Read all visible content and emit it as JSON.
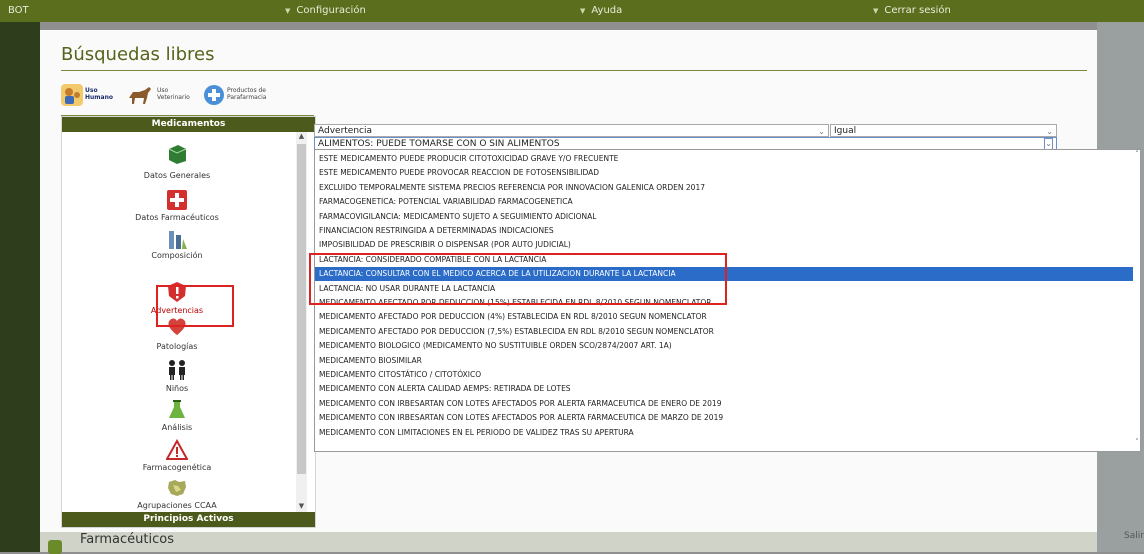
{
  "topbar": {
    "user": "BOT",
    "config": "Configuración",
    "help": "Ayuda",
    "logout": "Cerrar sesión"
  },
  "page": {
    "title": "Búsquedas libres",
    "salir": "Salir",
    "footer_partial": "Farmacéuticos"
  },
  "types": [
    {
      "label1": "Uso",
      "label2": "Humano",
      "icon": "human-use-icon"
    },
    {
      "label1": "Uso",
      "label2": "Veterinario",
      "icon": "horse-icon"
    },
    {
      "label1": "Productos de",
      "label2": "Parafarmacia",
      "icon": "parapharmacy-icon"
    }
  ],
  "categories": {
    "header": "Medicamentos",
    "footer": "Principios Activos",
    "items": [
      {
        "label": "Datos Generales",
        "icon": "book-icon"
      },
      {
        "label": "Datos Farmacéuticos",
        "icon": "first-aid-icon"
      },
      {
        "label": "Composición",
        "icon": "flask-icon"
      },
      {
        "label": "Advertencias",
        "icon": "warning-shield-icon"
      },
      {
        "label": "Patologías",
        "icon": "heart-icon"
      },
      {
        "label": "Niños",
        "icon": "children-icon"
      },
      {
        "label": "Análisis",
        "icon": "lab-icon"
      },
      {
        "label": "Farmacogenética",
        "icon": "triangle-warning-icon"
      },
      {
        "label": "Agrupaciones CCAA",
        "icon": "map-icon"
      },
      {
        "label": "",
        "icon": "map-icon"
      }
    ]
  },
  "filter": {
    "field": "Advertencia",
    "operator": "Igual",
    "value": "ALIMENTOS: PUEDE TOMARSE CON O SIN ALIMENTOS"
  },
  "dropdown_options": [
    "ESTE MEDICAMENTO PUEDE PRODUCIR CITOTOXICIDAD GRAVE Y/O FRECUENTE",
    "ESTE MEDICAMENTO PUEDE PROVOCAR REACCION DE FOTOSENSIBILIDAD",
    "EXCLUIDO TEMPORALMENTE SISTEMA PRECIOS REFERENCIA POR INNOVACION GALENICA ORDEN 2017",
    "FARMACOGENETICA: POTENCIAL VARIABILIDAD FARMACOGENETICA",
    "FARMACOVIGILANCIA: MEDICAMENTO SUJETO A SEGUIMIENTO ADICIONAL",
    "FINANCIACION RESTRINGIDA A DETERMINADAS INDICACIONES",
    "IMPOSIBILIDAD DE PRESCRIBIR O DISPENSAR (POR AUTO JUDICIAL)",
    "LACTANCIA: CONSIDERADO COMPATIBLE CON LA LACTANCIA",
    "LACTANCIA: CONSULTAR CON EL MEDICO ACERCA DE LA UTILIZACION DURANTE LA LACTANCIA",
    "LACTANCIA: NO USAR DURANTE LA LACTANCIA",
    "MEDICAMENTO AFECTADO POR DEDUCCION (15%) ESTABLECIDA EN RDL 8/2010 SEGUN NOMENCLATOR",
    "MEDICAMENTO AFECTADO POR DEDUCCION (4%) ESTABLECIDA EN RDL 8/2010 SEGUN NOMENCLATOR",
    "MEDICAMENTO AFECTADO POR DEDUCCION (7,5%) ESTABLECIDA EN RDL 8/2010 SEGUN NOMENCLATOR",
    "MEDICAMENTO BIOLOGICO (MEDICAMENTO NO SUSTITUIBLE ORDEN SCO/2874/2007 ART. 1A)",
    "MEDICAMENTO BIOSIMILAR",
    "MEDICAMENTO CITOSTÁTICO / CITOTÓXICO",
    "MEDICAMENTO CON ALERTA CALIDAD AEMPS: RETIRADA DE LOTES",
    "MEDICAMENTO CON IRBESARTAN CON LOTES AFECTADOS POR ALERTA FARMACEUTICA DE ENERO DE 2019",
    "MEDICAMENTO CON IRBESARTAN CON LOTES AFECTADOS POR ALERTA FARMACEUTICA DE MARZO DE 2019",
    "MEDICAMENTO CON LIMITACIONES EN EL PERIODO DE VALIDEZ TRAS SU APERTURA"
  ],
  "selected_option_index": 8,
  "colors": {
    "brand": "#5b6e1e",
    "selected": "#2a6cc7",
    "highlight": "#d22222"
  }
}
